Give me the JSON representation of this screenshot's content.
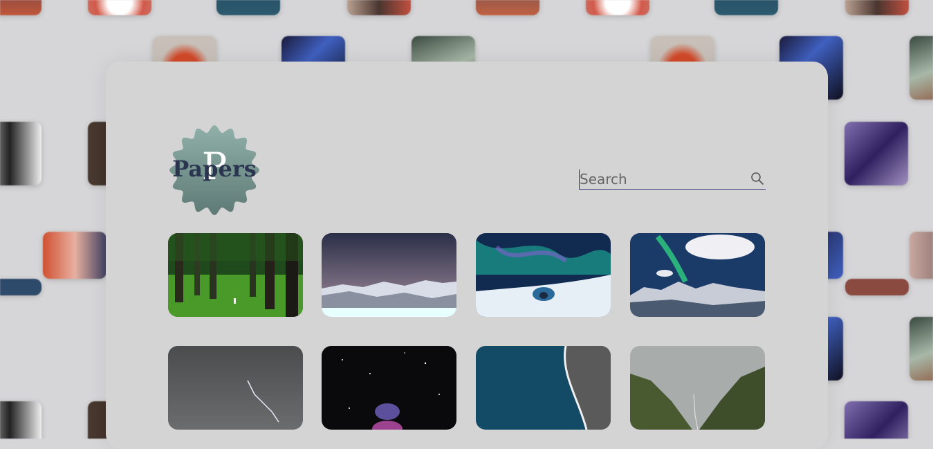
{
  "app": {
    "logo_text": "Papers",
    "logo_letter": "P"
  },
  "search": {
    "placeholder": "Search",
    "value": ""
  },
  "gallery": {
    "items": [
      {
        "name": "forest"
      },
      {
        "name": "snowy-mountains-night"
      },
      {
        "name": "aurora-igloo"
      },
      {
        "name": "aurora-coast"
      },
      {
        "name": "storm-lightning"
      },
      {
        "name": "nebula"
      },
      {
        "name": "ocean-beach-aerial"
      },
      {
        "name": "green-valley"
      }
    ]
  },
  "colors": {
    "panel": "#d4d4d4",
    "background": "#d6d6d8",
    "logo_badge": "#7f9e98",
    "logo_text": "#2b3550"
  }
}
